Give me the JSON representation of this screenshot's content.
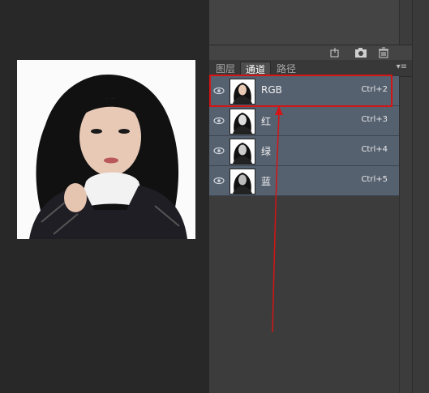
{
  "panel": {
    "tabs": [
      {
        "label": "图层",
        "active": false
      },
      {
        "label": "通道",
        "active": true
      },
      {
        "label": "路径",
        "active": false
      }
    ],
    "menu_icon": "panel-menu-icon",
    "icons": [
      "channel-to-selection-icon",
      "save-selection-icon",
      "delete-channel-icon"
    ]
  },
  "channels": [
    {
      "name": "RGB",
      "shortcut": "Ctrl+2",
      "visible": true,
      "selected": true
    },
    {
      "name": "红",
      "shortcut": "Ctrl+3",
      "visible": true,
      "selected": false
    },
    {
      "name": "绿",
      "shortcut": "Ctrl+4",
      "visible": true,
      "selected": false
    },
    {
      "name": "蓝",
      "shortcut": "Ctrl+5",
      "visible": true,
      "selected": false
    }
  ],
  "colors": {
    "canvas_bg": "#282828",
    "panel_bg": "#3c3c3c",
    "row_bg": "#566170",
    "annotation": "#d31515"
  }
}
